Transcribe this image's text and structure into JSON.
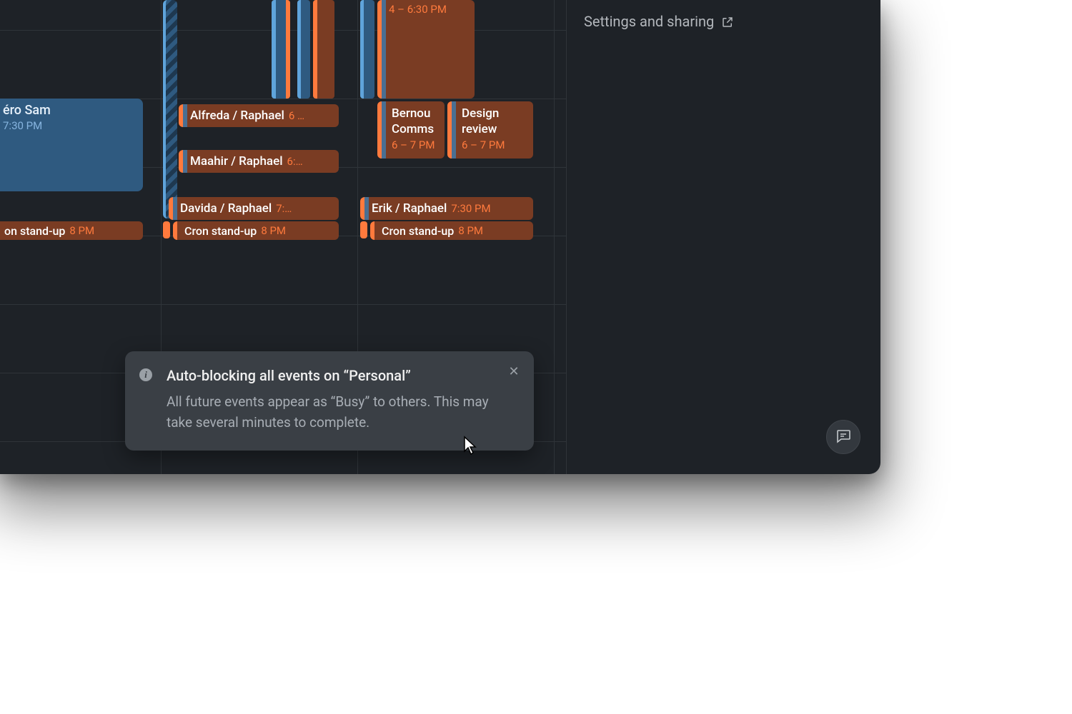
{
  "sidebar": {
    "settings_label": "Settings and sharing"
  },
  "toast": {
    "title": "Auto-blocking all events on “Personal”",
    "body": "All future events appear as “Busy” to others. This may take several minutes to complete."
  },
  "events": {
    "ero_sam": {
      "title": "éro Sam",
      "time": "7:30 PM"
    },
    "on_standup_left": {
      "title": "on stand-up",
      "time": "8 PM"
    },
    "alfreda": {
      "title": "Alfreda / Raphael",
      "time": "6 …"
    },
    "maahir": {
      "title": "Maahir / Raphael",
      "time": "6:…"
    },
    "davida": {
      "title": "Davida / Raphael",
      "time": "7:…"
    },
    "cron_mid": {
      "title": "Cron stand-up",
      "time": "8 PM"
    },
    "tall_time": {
      "time": "4 – 6:30 PM"
    },
    "bernou": {
      "title": "Bernou Comms",
      "time": "6 – 7 PM"
    },
    "design": {
      "title": "Design review",
      "time": "6 – 7 PM"
    },
    "erik": {
      "title": "Erik / Raphael",
      "time": "7:30 PM"
    },
    "cron_right": {
      "title": "Cron stand-up",
      "time": "8 PM"
    }
  }
}
